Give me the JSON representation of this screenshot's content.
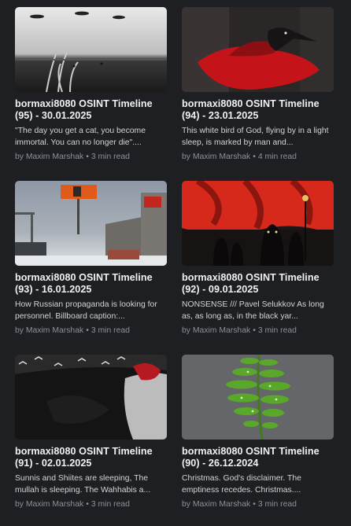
{
  "posts": [
    {
      "title": "bormaxi8080 OSINT Timeline (95) - 30.01.2025",
      "excerpt": "\"The day you get a cat, you become immortal. You can no longer die\"....",
      "author": "by Maxim Marshak",
      "read_time": "3 min read",
      "thumbnail": "ufo-field-icon"
    },
    {
      "title": "bormaxi8080 OSINT Timeline (94) - 23.01.2025",
      "excerpt": "This white bird of God, flying by in a light sleep, is marked by man and...",
      "author": "by Maxim Marshak",
      "read_time": "4 min read",
      "thumbnail": "crow-red-icon"
    },
    {
      "title": "bormaxi8080 OSINT Timeline (93) - 16.01.2025",
      "excerpt": "How Russian propaganda is looking for personnel. Billboard caption:...",
      "author": "by Maxim Marshak",
      "read_time": "3 min read",
      "thumbnail": "street-billboard-icon"
    },
    {
      "title": "bormaxi8080 OSINT Timeline (92) - 09.01.2025",
      "excerpt": "NONSENSE /// Pavel Selukkov As long as, as long as, in the black yar...",
      "author": "by Maxim Marshak",
      "read_time": "3 min read",
      "thumbnail": "red-sky-figures-icon"
    },
    {
      "title": "bormaxi8080 OSINT Timeline (91) - 02.01.2025",
      "excerpt": "Sunnis and Shiites are sleeping, The mullah is sleeping. The Wahhabis a...",
      "author": "by Maxim Marshak",
      "read_time": "3 min read",
      "thumbnail": "dark-birds-icon"
    },
    {
      "title": "bormaxi8080 OSINT Timeline (90) - 26.12.2024",
      "excerpt": "Christmas. God's disclaimer. The emptiness recedes. Christmas....",
      "author": "by Maxim Marshak",
      "read_time": "3 min read",
      "thumbnail": "fern-leaf-icon"
    }
  ],
  "separator": "•"
}
